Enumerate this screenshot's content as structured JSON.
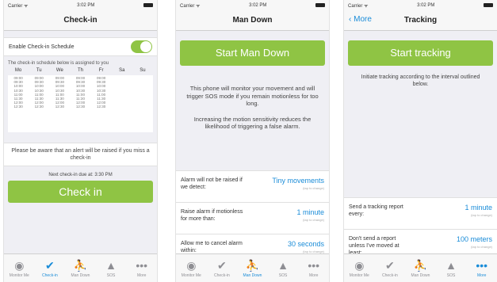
{
  "status_bar": {
    "carrier": "Carrier ᯤ",
    "time": "3:02 PM"
  },
  "checkin": {
    "title": "Check-in",
    "toggle_label": "Enable Check-in Schedule",
    "toggle_on": true,
    "schedule_note": "The check-in schedule below is assigned to you",
    "days": [
      "Mo",
      "Tu",
      "We",
      "Th",
      "Fr",
      "Sa",
      "Su"
    ],
    "times": [
      [
        "09:00",
        "09:30",
        "10:00",
        "10:30",
        "11:00",
        "11:30",
        "12:00",
        "12:30"
      ],
      [
        "09:00",
        "09:30",
        "10:00",
        "10:30",
        "11:00",
        "11:30",
        "12:00",
        "12:30"
      ],
      [
        "09:00",
        "09:30",
        "10:00",
        "10:30",
        "11:00",
        "11:30",
        "12:00",
        "12:30"
      ],
      [
        "09:00",
        "09:30",
        "10:00",
        "10:30",
        "11:00",
        "11:30",
        "12:00",
        "12:30"
      ],
      [
        "09:00",
        "09:30",
        "10:00",
        "10:30",
        "11:00",
        "11:30",
        "12:00",
        "12:30"
      ],
      [],
      []
    ],
    "alert_note": "Please be aware that an alert will be raised if you miss a check-in",
    "next_due": "Next check-in due at: 3:30 PM",
    "button": "Check in"
  },
  "mandown": {
    "title": "Man Down",
    "button": "Start Man Down",
    "desc1": "This phone will monitor your movement and will trigger SOS mode if you remain motionless for too long.",
    "desc2": "Increasing the motion sensitivity reduces the likelihood of triggering a false alarm.",
    "settings": [
      {
        "label": "Alarm will not be raised if we detect:",
        "value": "Tiny movements",
        "hint": "(tap to change)"
      },
      {
        "label": "Raise alarm if motionless for more than:",
        "value": "1 minute",
        "hint": "(tap to change)"
      },
      {
        "label": "Allow me to cancel alarm within:",
        "value": "30 seconds",
        "hint": "(tap to change)"
      }
    ]
  },
  "tracking": {
    "back": "More",
    "title": "Tracking",
    "button": "Start tracking",
    "desc": "Initiate tracking according to the interval outlined below.",
    "settings": [
      {
        "label": "Send a tracking report every:",
        "value": "1 minute",
        "hint": "(tap to change)"
      },
      {
        "label": "Don't send a report unless I've moved at least:",
        "value": "100 meters",
        "hint": "(tap to change)"
      }
    ]
  },
  "tabs": [
    {
      "label": "Monitor Me",
      "icon": "eye-icon",
      "glyph": "◉"
    },
    {
      "label": "Check-in",
      "icon": "checkmark-icon",
      "glyph": "✔"
    },
    {
      "label": "Man Down",
      "icon": "man-down-icon",
      "glyph": "⛹"
    },
    {
      "label": "SOS",
      "icon": "warning-icon",
      "glyph": "▲"
    },
    {
      "label": "More",
      "icon": "more-icon",
      "glyph": "•••"
    }
  ],
  "active_tab": {
    "checkin": 1,
    "mandown": 2,
    "tracking": 4
  }
}
